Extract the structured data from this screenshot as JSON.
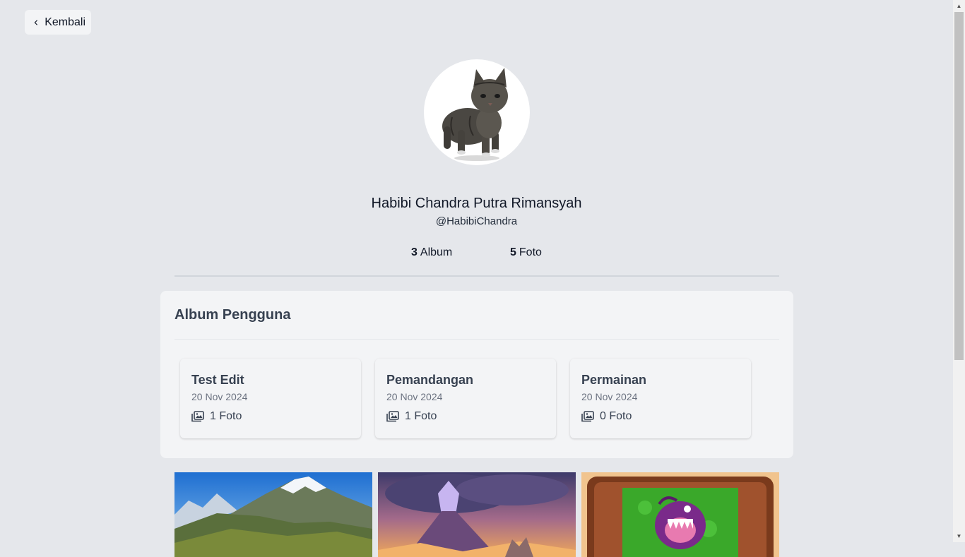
{
  "back_button": {
    "label": "Kembali",
    "icon": "chevron-left-icon"
  },
  "profile": {
    "avatar": "cat-photo",
    "name": "Habibi Chandra Putra Rimansyah",
    "username": "@HabibiChandra",
    "stats": {
      "album_count": "3",
      "album_label": "Album",
      "photo_count": "5",
      "photo_label": "Foto"
    }
  },
  "albums_section": {
    "title": "Album Pengguna",
    "albums": [
      {
        "title": "Test Edit",
        "date": "20 Nov 2024",
        "count": "1 Foto"
      },
      {
        "title": "Pemandangan",
        "date": "20 Nov 2024",
        "count": "1 Foto"
      },
      {
        "title": "Permainan",
        "date": "20 Nov 2024",
        "count": "0 Foto"
      }
    ]
  },
  "photos": [
    {
      "subject": "snowy-mountain-landscape"
    },
    {
      "subject": "purple-volcano-painting"
    },
    {
      "subject": "plants-vs-zombies-chomper"
    }
  ],
  "colors": {
    "background": "#e5e7eb",
    "panel": "#f3f4f6",
    "heading": "#374151",
    "muted": "#6b7280"
  }
}
